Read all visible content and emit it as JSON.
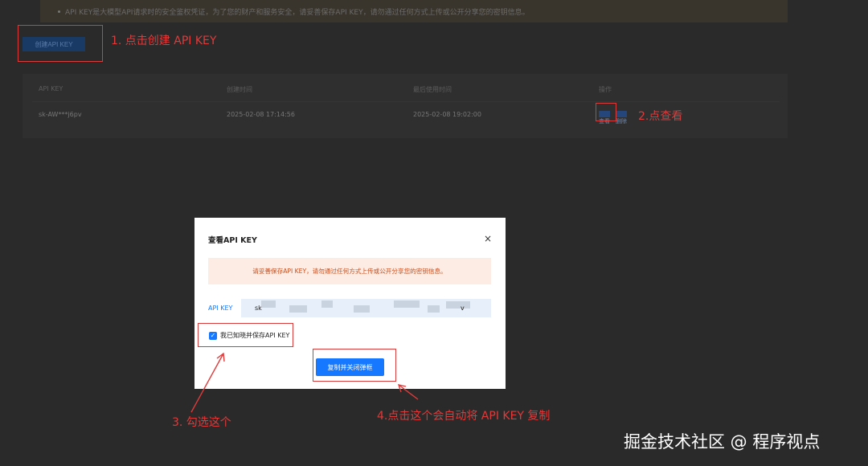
{
  "background": {
    "notice": "API KEY是大模型API请求时的安全鉴权凭证，为了您的财产和服务安全，请妥善保存API KEY，请勿通过任何方式上传或公开分享您的密钥信息。",
    "create_button": "创建API KEY",
    "table": {
      "headers": [
        "API KEY",
        "创建时间",
        "最后使用时间",
        "操作"
      ],
      "row": {
        "key": "sk-AW***j6pv",
        "created": "2025-02-08 17:14:56",
        "last_used": "2025-02-08 19:02:00",
        "view": "查看",
        "delete": "删除"
      }
    }
  },
  "modal": {
    "title": "查看API KEY",
    "close": "×",
    "warning": "请妥善保存API KEY，请勿通过任何方式上传或公开分享您的密钥信息。",
    "key_label": "API KEY",
    "key_prefix": "sk",
    "key_suffix": "v",
    "ack_label": "我已知晓并保存API KEY",
    "ack_checked": true,
    "copy_button": "复制并关闭弹框"
  },
  "annotations": {
    "step1": "1. 点击创建 API KEY",
    "step2": "2.点查看",
    "step3": "3. 勾选这个",
    "step4": "4.点击这个会自动将 API KEY 复制"
  },
  "watermark": "掘金技术社区 @ 程序视点",
  "colors": {
    "primary": "#1677ff",
    "annotation_red": "#e03a3a",
    "warning_bg": "#fcece3"
  }
}
